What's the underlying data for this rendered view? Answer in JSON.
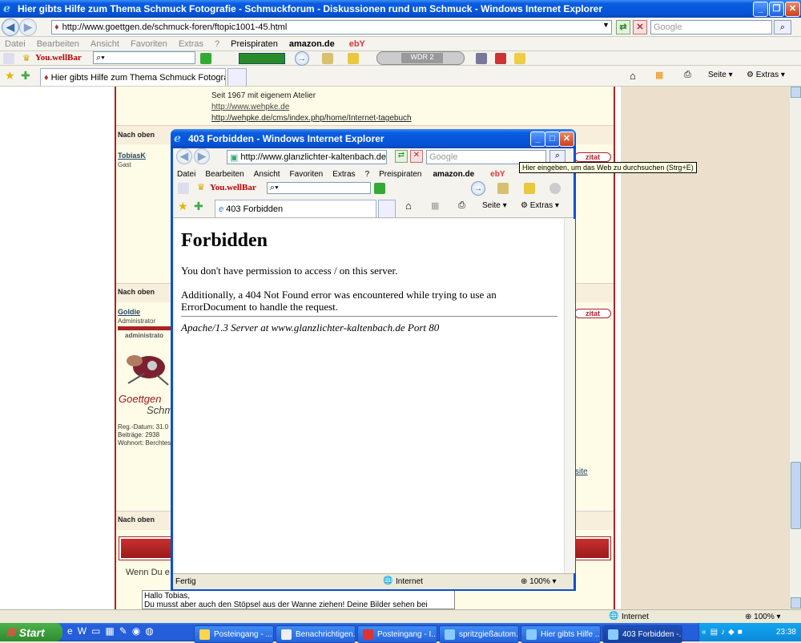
{
  "main_window": {
    "title": "Hier gibts Hilfe zum Thema Schmuck Fotografie - Schmuckforum - Diskussionen rund um Schmuck - Windows Internet Explorer",
    "address": "http://www.goettgen.de/schmuck-foren/ftopic1001-45.html",
    "search_placeholder": "Google",
    "menu": [
      "Datei",
      "Bearbeiten",
      "Ansicht",
      "Favoriten",
      "Extras",
      "?",
      "Preispiraten"
    ],
    "amazon_label": "amazon.de",
    "ebay_label": "ebY",
    "youwell_label": "You.wellBar",
    "radio_label": "WDR 2",
    "tab_label": "Hier gibts Hilfe zum Thema Schmuck Fotografie - Schm...",
    "page_label": "Seite",
    "extras_label": "Extras",
    "status_zone": "Internet",
    "status_zoom": "100%"
  },
  "forum": {
    "sig_line": "Seit 1967 mit eigenem Atelier",
    "link1": "http://www.wehpke.de",
    "link2": "http://wehpke.de/cms/index.php/home/Internet-tagebuch",
    "nach_oben": "Nach oben",
    "user1_name": "TobiasK",
    "user1_role": "Gast",
    "user2_name": "Goldie",
    "user2_role": "Administrator",
    "user2_rank": "administrato",
    "logo_text1": "Goettgen",
    "logo_text2": "Schm",
    "reg_datum": "Reg.-Datum: 31.0",
    "beitraege": "Beiträge: 2938",
    "wohnort": "Wohnort: Berchtes",
    "zitat": "zitat",
    "side_link": "site",
    "wenn": "Wenn Du e",
    "reply_line1": "Hallo Tobias,",
    "reply_line2": "Du musst aber auch den Stöpsel aus der Wanne ziehen! Deine Bilder sehen bei"
  },
  "popup": {
    "title": "403 Forbidden - Windows Internet Explorer",
    "address": "http://www.glanzlichter-kaltenbach.de/",
    "search_placeholder": "Google",
    "tooltip": "Hier eingeben, um das Web zu durchsuchen (Strg+E)",
    "menu": [
      "Datei",
      "Bearbeiten",
      "Ansicht",
      "Favoriten",
      "Extras",
      "?",
      "Preispiraten"
    ],
    "amazon_label": "amazon.de",
    "ebay_label": "ebY",
    "youwell_label": "You.wellBar",
    "tab_label": "403 Forbidden",
    "page_label": "Seite",
    "extras_label": "Extras",
    "heading": "Forbidden",
    "para1": "You don't have permission to access / on this server.",
    "para2": "Additionally, a 404 Not Found error was encountered while trying to use an ErrorDocument to handle the request.",
    "server": "Apache/1.3 Server at www.glanzlichter-kaltenbach.de Port 80",
    "status_left": "Fertig",
    "status_zone": "Internet",
    "status_zoom": "100%"
  },
  "taskbar": {
    "start": "Start",
    "buttons": [
      "Posteingang - ...",
      "Benachrichtigen...",
      "Posteingang - I...",
      "spritzgießautom...",
      "Hier gibts Hilfe ...",
      "403 Forbidden -..."
    ],
    "clock": "23:38"
  }
}
